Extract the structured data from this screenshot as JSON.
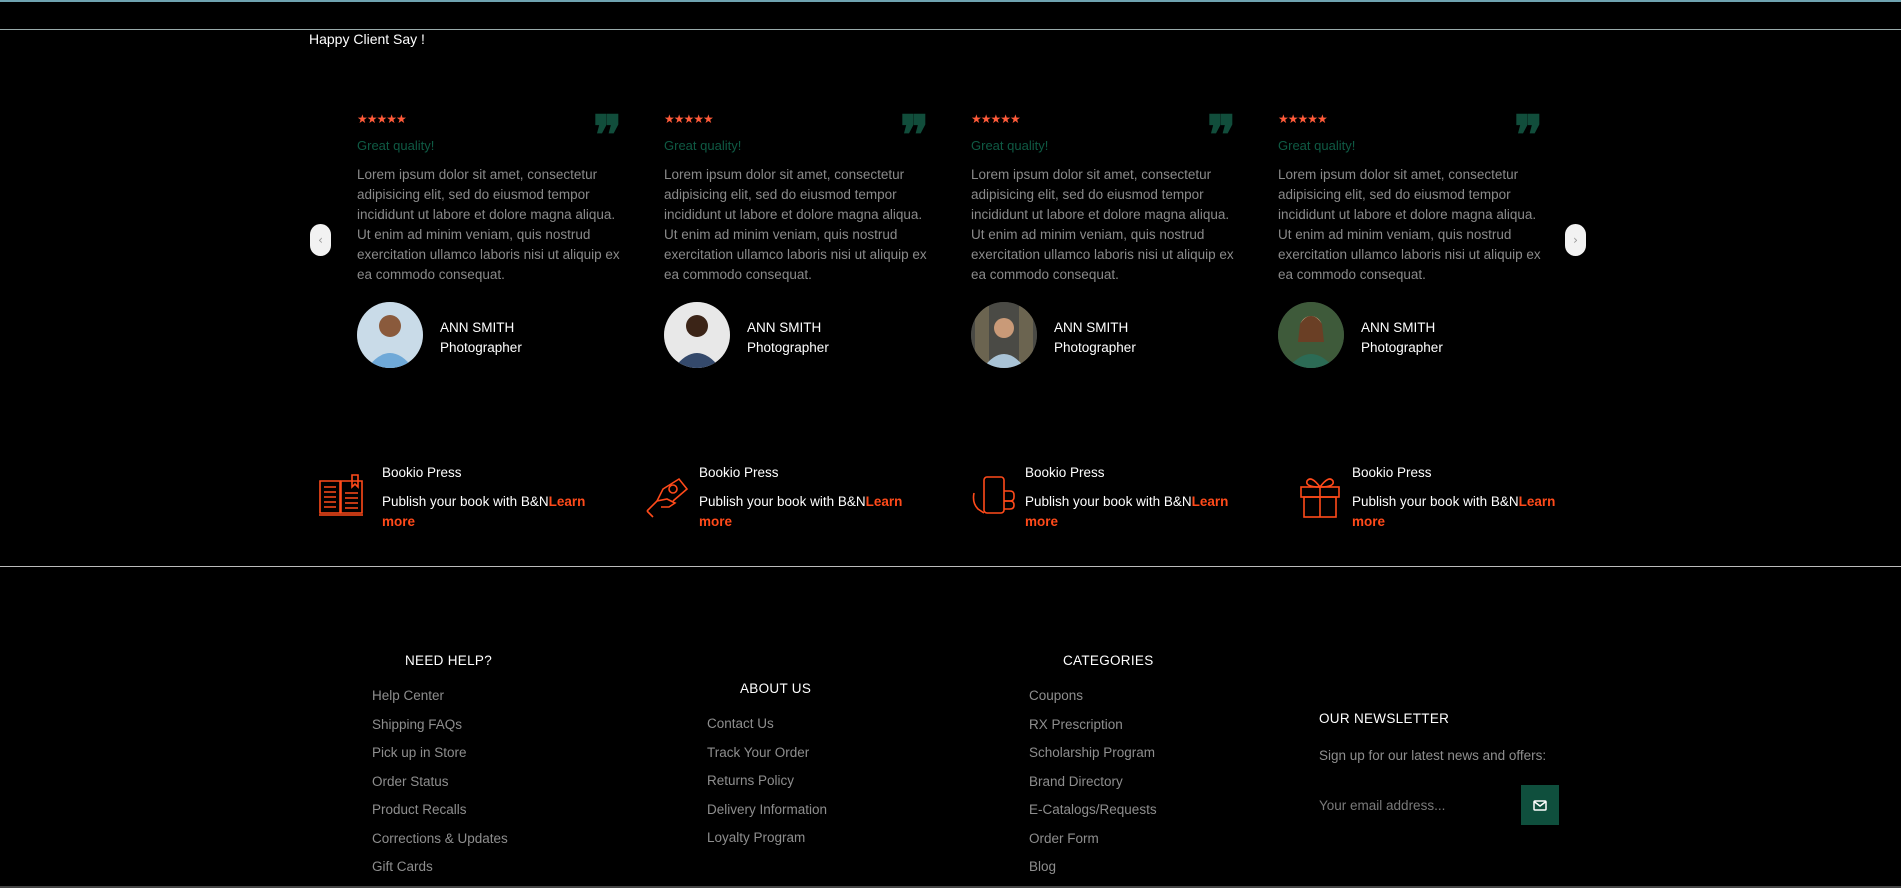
{
  "section": {
    "title": "Happy Client Say !"
  },
  "colors": {
    "accent": "#ff4a1a",
    "brand_green": "#0f4f3d",
    "star": "#ff5b3a"
  },
  "testimonials": [
    {
      "stars": "★★★★★",
      "quote_icon": "quote-icon",
      "heading": "Great quality!",
      "body": "Lorem ipsum dolor sit amet, consectetur adipisicing elit, sed do eiusmod tempor incididunt ut labore et dolore magna aliqua. Ut enim ad minim veniam, quis nostrud exercitation ullamco laboris nisi ut aliquip ex ea commodo consequat.",
      "name": "ANN SMITH",
      "role": "Photographer"
    },
    {
      "stars": "★★★★★",
      "quote_icon": "quote-icon",
      "heading": "Great quality!",
      "body": "Lorem ipsum dolor sit amet, consectetur adipisicing elit, sed do eiusmod tempor incididunt ut labore et dolore magna aliqua. Ut enim ad minim veniam, quis nostrud exercitation ullamco laboris nisi ut aliquip ex ea commodo consequat.",
      "name": "ANN SMITH",
      "role": "Photographer"
    },
    {
      "stars": "★★★★★",
      "quote_icon": "quote-icon",
      "heading": "Great quality!",
      "body": "Lorem ipsum dolor sit amet, consectetur adipisicing elit, sed do eiusmod tempor incididunt ut labore et dolore magna aliqua. Ut enim ad minim veniam, quis nostrud exercitation ullamco laboris nisi ut aliquip ex ea commodo consequat.",
      "name": "ANN SMITH",
      "role": "Photographer"
    },
    {
      "stars": "★★★★★",
      "quote_icon": "quote-icon",
      "heading": "Great quality!",
      "body": "Lorem ipsum dolor sit amet, consectetur adipisicing elit, sed do eiusmod tempor incididunt ut labore et dolore magna aliqua. Ut enim ad minim veniam, quis nostrud exercitation ullamco laboris nisi ut aliquip ex ea commodo consequat.",
      "name": "ANN SMITH",
      "role": "Photographer"
    }
  ],
  "carousel": {
    "prev_icon": "chevron-left-icon",
    "prev_label": "‹",
    "next_icon": "chevron-right-icon",
    "next_label": "›"
  },
  "features": [
    {
      "icon": "book-open-icon",
      "title": "Bookio Press",
      "text": "Publish your book with B&N",
      "link": "Learn more"
    },
    {
      "icon": "hand-money-icon",
      "title": "Bookio Press",
      "text": "Publish your book with B&N",
      "link": "Learn more"
    },
    {
      "icon": "phone-hand-icon",
      "title": "Bookio Press",
      "text": "Publish your book with B&N",
      "link": "Learn more"
    },
    {
      "icon": "gift-icon",
      "title": "Bookio Press",
      "text": "Publish your book with B&N",
      "link": "Learn more"
    }
  ],
  "footer": {
    "need_help": {
      "title": "NEED HELP?",
      "items": [
        "Help Center",
        "Shipping FAQs",
        "Pick up in Store",
        "Order Status",
        "Product Recalls",
        "Corrections & Updates",
        "Gift Cards"
      ]
    },
    "about_us": {
      "title": "ABOUT US",
      "items": [
        "Contact Us",
        "Track Your Order",
        "Returns Policy",
        "Delivery Information",
        "Loyalty Program"
      ]
    },
    "categories": {
      "title": "CATEGORIES",
      "items": [
        "Coupons",
        "RX Prescription",
        "Scholarship Program",
        "Brand Directory",
        "E-Catalogs/Requests",
        "Order Form",
        "Blog"
      ]
    },
    "newsletter": {
      "title": "OUR NEWSLETTER",
      "text": "Sign up for our latest news and offers:",
      "placeholder": "Your email address...",
      "send_icon": "envelope-icon"
    }
  }
}
